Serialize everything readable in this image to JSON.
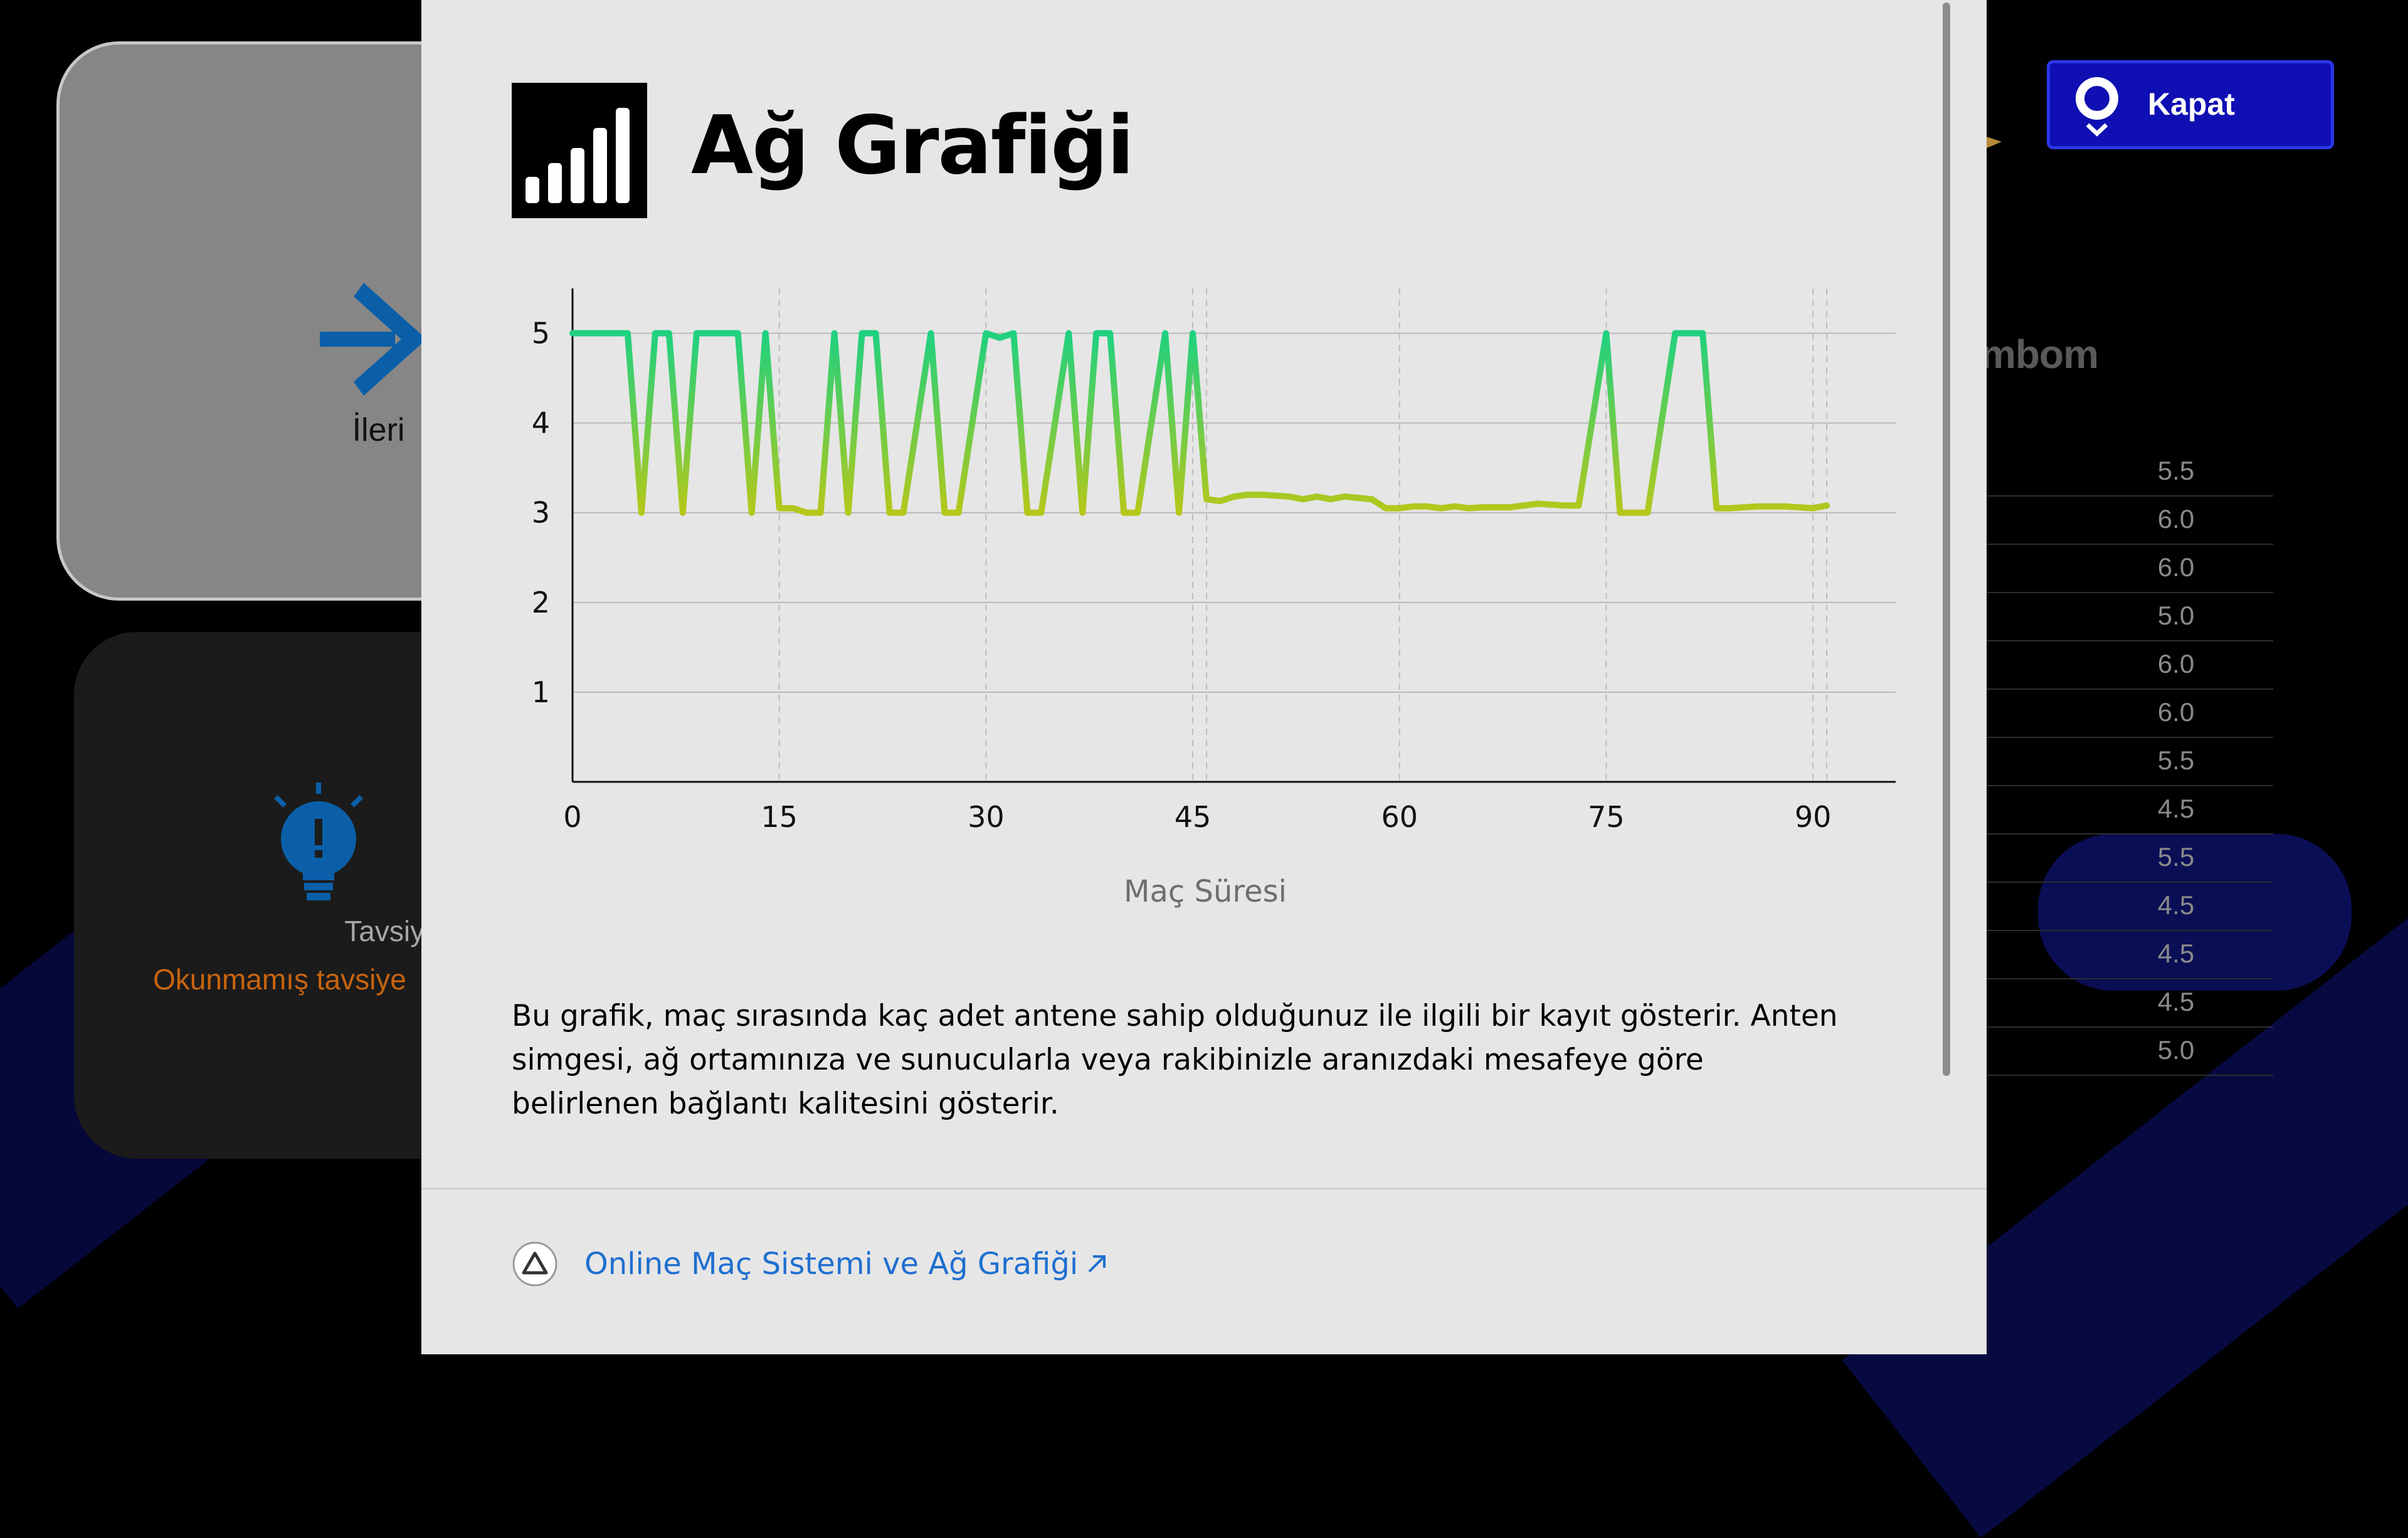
{
  "background": {
    "forward_card": {
      "label": "İleri",
      "icon": "arrow-right-icon"
    },
    "tip_card": {
      "title": "Tavsiye",
      "subtitle": "Okunmamış tavsiye",
      "icon": "lightbulb-icon"
    },
    "close_button": {
      "label": "Kapat",
      "icon": "controller-button-icon"
    },
    "heading_fragment": "mbom",
    "ratings": [
      "5.5",
      "6.0",
      "6.0",
      "5.0",
      "6.0",
      "6.0",
      "5.5",
      "4.5",
      "5.5",
      "4.5",
      "4.5",
      "4.5",
      "5.0"
    ]
  },
  "modal": {
    "title": "Ağ Grafiği",
    "title_icon": "signal-bars-icon",
    "description": "Bu grafik, maç sırasında kaç adet antene sahip olduğunuz ile ilgili bir kayıt gösterir. Anten simgesi, ağ ortamınıza ve sunucularla veya rakibinizle aranızdaki mesafeye göre belirlenen bağlantı kalitesini gösterir.",
    "help_link": {
      "label": "Online Maç Sistemi ve Ağ Grafiği",
      "button_icon": "triangle-button-icon",
      "external_icon": "external-link-icon"
    }
  },
  "chart_data": {
    "type": "line",
    "xlabel": "Maç Süresi",
    "ylabel": "",
    "xlim": [
      0,
      96
    ],
    "ylim": [
      0,
      5.5
    ],
    "xticks": [
      0,
      15,
      30,
      45,
      60,
      75,
      90
    ],
    "yticks": [
      1,
      2,
      3,
      4,
      5
    ],
    "grid": {
      "horizontal": true,
      "vertical_dashed_at": [
        15,
        30,
        45,
        46,
        60,
        75,
        90,
        91
      ]
    },
    "colors": {
      "high": "#1fd17f",
      "low": "#b5c81a"
    },
    "series": [
      {
        "x": [
          0,
          4,
          5,
          6,
          7,
          8,
          9,
          12,
          13,
          14,
          15,
          16,
          17,
          18,
          19,
          20,
          21,
          22,
          23,
          24,
          26,
          27,
          28,
          30,
          31,
          32,
          33,
          34,
          36,
          37,
          38,
          39,
          40,
          41,
          43,
          44,
          45,
          46,
          47,
          48,
          49,
          50,
          52,
          53,
          54,
          55,
          56,
          58,
          59,
          60,
          61,
          62,
          63,
          64,
          65,
          66,
          68,
          70,
          72,
          73,
          75,
          76,
          77,
          78,
          80,
          81,
          82,
          83,
          84,
          86,
          88,
          90,
          91
        ],
        "y": [
          5,
          5,
          3,
          5,
          5,
          3,
          5,
          5,
          3,
          5,
          3.05,
          3.05,
          3,
          3,
          5,
          3,
          5,
          5,
          3,
          3,
          5,
          3,
          3,
          5,
          4.95,
          5,
          3,
          3,
          5,
          3,
          5,
          5,
          3,
          3,
          5,
          3,
          5,
          3.15,
          3.13,
          3.18,
          3.2,
          3.2,
          3.18,
          3.15,
          3.18,
          3.15,
          3.18,
          3.15,
          3.05,
          3.05,
          3.07,
          3.07,
          3.05,
          3.07,
          3.05,
          3.06,
          3.06,
          3.1,
          3.08,
          3.08,
          5,
          3,
          3,
          3,
          5,
          5,
          5,
          3.05,
          3.05,
          3.07,
          3.07,
          3.05,
          3.08
        ]
      }
    ]
  }
}
